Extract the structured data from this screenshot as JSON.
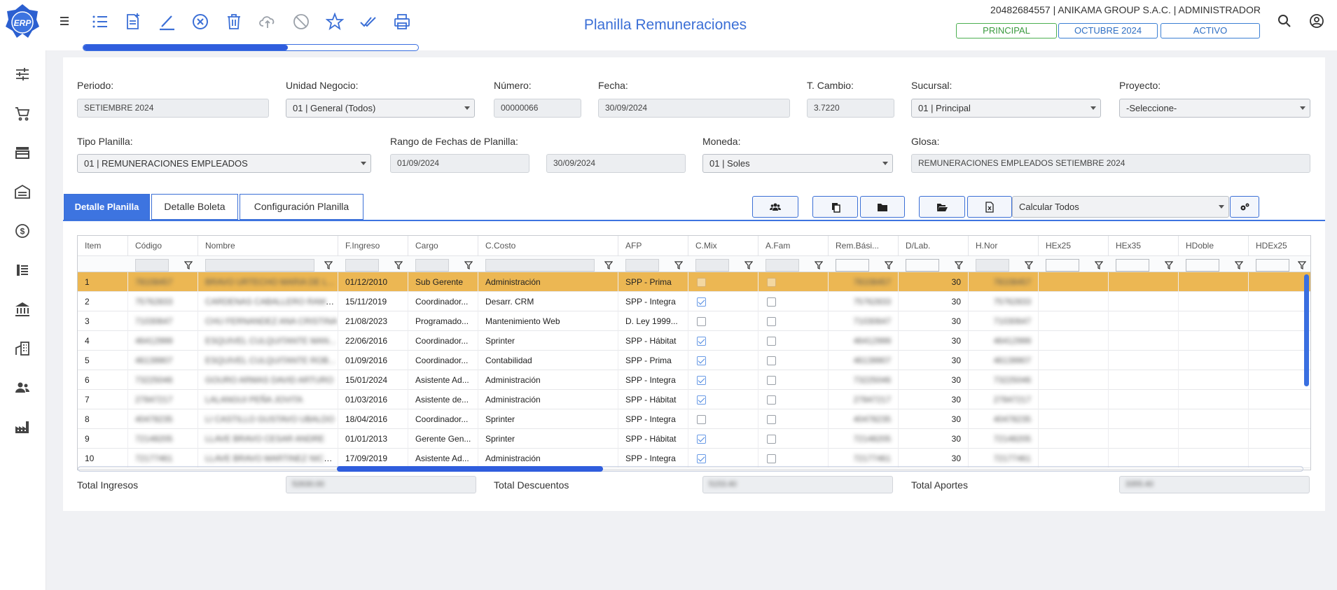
{
  "app": {
    "logo_text": "ERP",
    "title": "Planilla Remuneraciones",
    "company_line": "20482684557 | ANIKAMA GROUP S.A.C. | ADMINISTRADOR"
  },
  "status_pills": {
    "module": "PRINCIPAL",
    "period": "OCTUBRE 2024",
    "state": "ACTIVO"
  },
  "progress": {
    "fraction": 0.61
  },
  "toolbar_icons": [
    "menu-icon",
    "list-icon",
    "new-document-icon",
    "edit-icon",
    "cancel-icon",
    "delete-icon",
    "upload-cloud-icon",
    "disable-icon",
    "favorite-icon",
    "approve-icon",
    "print-icon"
  ],
  "sidebar_icons": [
    "settings-sliders-icon",
    "cart-icon",
    "store-icon",
    "warehouse-icon",
    "currency-icon",
    "ledger-icon",
    "bank-icon",
    "building-icon",
    "users-icon",
    "factory-icon"
  ],
  "form": {
    "periodo": {
      "label": "Periodo:",
      "value": "SETIEMBRE 2024"
    },
    "unidad_negocio": {
      "label": "Unidad Negocio:",
      "value": "01 | General (Todos)"
    },
    "numero": {
      "label": "Número:",
      "value": "00000066"
    },
    "fecha": {
      "label": "Fecha:",
      "value": "30/09/2024"
    },
    "tcambio": {
      "label": "T. Cambio:",
      "value": "3.7220"
    },
    "sucursal": {
      "label": "Sucursal:",
      "value": "01 | Principal"
    },
    "proyecto": {
      "label": "Proyecto:",
      "value": "-Seleccione-"
    },
    "tipo_planilla": {
      "label": "Tipo Planilla:",
      "value": "01 | REMUNERACIONES EMPLEADOS"
    },
    "rango": {
      "label": "Rango de Fechas de Planilla:",
      "desde": "01/09/2024",
      "hasta": "30/09/2024"
    },
    "moneda": {
      "label": "Moneda:",
      "value": "01 | Soles"
    },
    "glosa": {
      "label": "Glosa:",
      "value": "REMUNERACIONES EMPLEADOS SETIEMBRE 2024"
    }
  },
  "tabs": [
    "Detalle Planilla",
    "Detalle Boleta",
    "Configuración Planilla"
  ],
  "calc": {
    "value": "Calcular Todos"
  },
  "grid": {
    "columns": [
      "Item",
      "Código",
      "Nombre",
      "F.Ingreso",
      "Cargo",
      "C.Costo",
      "AFP",
      "C.Mix",
      "A.Fam",
      "Rem.Bási...",
      "D/Lab.",
      "H.Nor",
      "HEx25",
      "HEx35",
      "HDoble",
      "HDEx25"
    ],
    "rows": [
      {
        "item": "1",
        "codigo": "78108457",
        "nombre": "BRAVO URTECHO MARIA DE L...",
        "fingreso": "01/12/2010",
        "cargo": "Sub Gerente",
        "ccosto": "Administración",
        "afp": "SPP - Prima",
        "cmix": false,
        "afam": false,
        "rem": "78108457",
        "dlab": "30",
        "hnor": "78108457",
        "selected": true
      },
      {
        "item": "2",
        "codigo": "75762833",
        "nombre": "CARDENAS CABALLERO RAMON",
        "fingreso": "15/11/2019",
        "cargo": "Coordinador...",
        "ccosto": "Desarr. CRM",
        "afp": "SPP - Integra",
        "cmix": true,
        "afam": false,
        "rem": "75762833",
        "dlab": "30",
        "hnor": "75762833",
        "selected": false
      },
      {
        "item": "3",
        "codigo": "71030647",
        "nombre": "CHU FERNANDEZ ANA CRISTINA",
        "fingreso": "21/08/2023",
        "cargo": "Programado...",
        "ccosto": "Mantenimiento Web",
        "afp": "D. Ley 1999...",
        "cmix": false,
        "afam": false,
        "rem": "71030647",
        "dlab": "30",
        "hnor": "71030647",
        "selected": false
      },
      {
        "item": "4",
        "codigo": "46412999",
        "nombre": "ESQUIVEL CULQUITANTE MAN...",
        "fingreso": "22/06/2016",
        "cargo": "Coordinador...",
        "ccosto": "Sprinter",
        "afp": "SPP - Hábitat",
        "cmix": true,
        "afam": false,
        "rem": "46412999",
        "dlab": "30",
        "hnor": "46412999",
        "selected": false
      },
      {
        "item": "5",
        "codigo": "46139907",
        "nombre": "ESQUIVEL CULQUITANTE ROB...",
        "fingreso": "01/09/2016",
        "cargo": "Coordinador...",
        "ccosto": "Contabilidad",
        "afp": "SPP - Prima",
        "cmix": true,
        "afam": false,
        "rem": "46139907",
        "dlab": "30",
        "hnor": "46139907",
        "selected": false
      },
      {
        "item": "6",
        "codigo": "73225046",
        "nombre": "GOURO ARMAS DAVID ARTURO",
        "fingreso": "15/01/2024",
        "cargo": "Asistente Ad...",
        "ccosto": "Administración",
        "afp": "SPP - Integra",
        "cmix": true,
        "afam": false,
        "rem": "73225046",
        "dlab": "30",
        "hnor": "73225046",
        "selected": false
      },
      {
        "item": "7",
        "codigo": "27847217",
        "nombre": "LALANGUI PEÑA JOVITA",
        "fingreso": "01/03/2016",
        "cargo": "Asistente de...",
        "ccosto": "Administración",
        "afp": "SPP - Hábitat",
        "cmix": true,
        "afam": false,
        "rem": "27847217",
        "dlab": "30",
        "hnor": "27847217",
        "selected": false
      },
      {
        "item": "8",
        "codigo": "40478235",
        "nombre": "LI CASTILLO GUSTAVO UBALDO",
        "fingreso": "18/04/2016",
        "cargo": "Coordinador...",
        "ccosto": "Sprinter",
        "afp": "SPP - Integra",
        "cmix": false,
        "afam": false,
        "rem": "40478235",
        "dlab": "30",
        "hnor": "40478235",
        "selected": false
      },
      {
        "item": "9",
        "codigo": "72148205",
        "nombre": "LLAVE BRAVO CESAR ANDRE",
        "fingreso": "01/01/2013",
        "cargo": "Gerente Gen...",
        "ccosto": "Sprinter",
        "afp": "SPP - Hábitat",
        "cmix": true,
        "afam": false,
        "rem": "72148205",
        "dlab": "30",
        "hnor": "72148205",
        "selected": false
      },
      {
        "item": "10",
        "codigo": "72177461",
        "nombre": "LLAVE BRAVO MARTINEZ NICOLE",
        "fingreso": "17/09/2019",
        "cargo": "Asistente Ad...",
        "ccosto": "Administración",
        "afp": "SPP - Integra",
        "cmix": true,
        "afam": false,
        "rem": "72177461",
        "dlab": "30",
        "hnor": "72177461",
        "selected": false
      }
    ]
  },
  "totals": {
    "ingresos": {
      "label": "Total Ingresos",
      "value": "52630.00"
    },
    "descuentos": {
      "label": "Total Descuentos",
      "value": "5153.40"
    },
    "aportes": {
      "label": "Total Aportes",
      "value": "3355.40"
    }
  },
  "colors": {
    "accent": "#3d74e0",
    "selected_row": "#ecb753",
    "title": "#3b6fd6",
    "pill_green": "#3a9a3e"
  }
}
